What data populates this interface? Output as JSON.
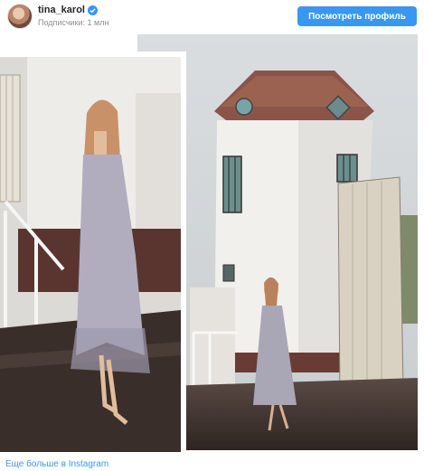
{
  "header": {
    "username": "tina_karol",
    "subscribers": "Подписчики: 1 млн",
    "view_profile_label": "Посмотреть профиль"
  },
  "footer": {
    "more_link": "Еще больше в Instagram"
  },
  "icons": {
    "verified": "verified-badge-icon"
  },
  "colors": {
    "accent": "#3897f0",
    "username": "#262626",
    "muted": "#8e8e8e"
  }
}
